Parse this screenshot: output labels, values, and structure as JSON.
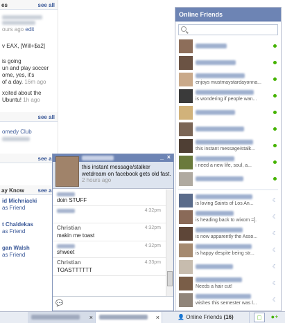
{
  "left_feed": {
    "see_all_label": "see all",
    "sections": [
      {
        "see_all": "see all",
        "header_title": "es"
      },
      {
        "see_all": "see all"
      },
      {
        "see_all": "see all"
      },
      {
        "see_all": "see all",
        "header_title": "ay Know"
      }
    ],
    "time_edit": "ours ago",
    "edit_label": "edit",
    "feed_line1": "v EAX, [Will+$a2]",
    "feed_line2": "is going",
    "feed_line3": "un and play soccer",
    "feed_line4": "ome, yes, it's",
    "feed_line5": "of a day.",
    "feed_line5_time": "16m ago",
    "feed_line6": "xcited about the",
    "feed_line7": "Ubuntu!",
    "feed_line7_time": "1h ago",
    "club_link": "omedy Club",
    "people": [
      {
        "name": "id Michniacki",
        "action": "as Friend"
      },
      {
        "name": "t Chaldekas",
        "action": "as Friend"
      },
      {
        "name": "gan Walsh",
        "action": "as Friend"
      }
    ]
  },
  "friends_panel": {
    "title": "Online Friends",
    "statuses": [
      "",
      "",
      "enjoys mustmaystardayonna...",
      "is wondering if people wan...",
      "",
      "",
      "this instant message/stalk...",
      "i need a new life, soul, a...",
      "",
      "is loving Saints of Los An...",
      "is heading back to wixom =].",
      "is now apparently the Asso...",
      "is happy despite being str...",
      "",
      "Needs a hair cut!",
      "wishes this semester was l..."
    ]
  },
  "chat": {
    "status_text": "this instant message/stalker wetdream on facebook gets old fast.",
    "status_ago": "2 hours ago",
    "minimize": "_",
    "close": "×",
    "messages": [
      {
        "sender": "",
        "time": "",
        "text": "doin STUFF"
      },
      {
        "sender": "",
        "time": "4:32pm",
        "text": ""
      },
      {
        "sender": "Christian",
        "time": "4:32pm",
        "text": "makin me toast"
      },
      {
        "sender": "",
        "time": "4:32pm",
        "text": "shweet"
      },
      {
        "sender": "Christian",
        "time": "4:33pm",
        "text": "TOASTTTTTT"
      }
    ]
  },
  "bottom_bar": {
    "tab_close": "×",
    "online_label": "Online Friends",
    "online_count": "(16)"
  },
  "colors": {
    "header_blue": "#6d84b4",
    "online_green": "#44b300",
    "link_blue": "#3b5998"
  }
}
